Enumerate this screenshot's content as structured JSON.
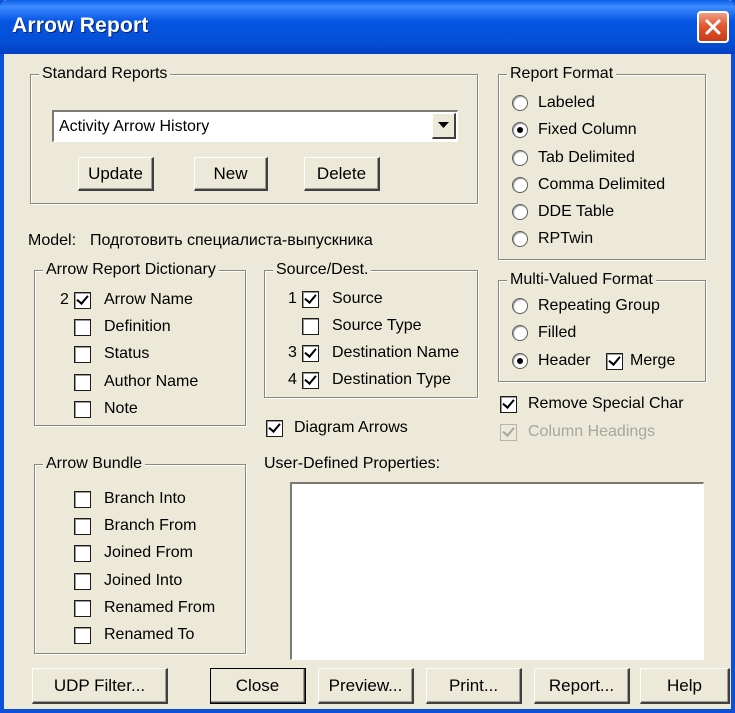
{
  "window": {
    "title": "Arrow Report"
  },
  "standard_reports": {
    "legend": "Standard Reports",
    "selected": "Activity Arrow History",
    "buttons": {
      "update": "Update",
      "new": "New",
      "delete": "Delete"
    }
  },
  "report_format": {
    "legend": "Report Format",
    "options": [
      "Labeled",
      "Fixed Column",
      "Tab Delimited",
      "Comma Delimited",
      "DDE Table",
      "RPTwin"
    ],
    "selected": "Fixed Column"
  },
  "model": {
    "label": "Model:",
    "value": "Подготовить специалиста-выпускника"
  },
  "arrow_report_dictionary": {
    "legend": "Arrow Report Dictionary",
    "items": [
      {
        "label": "Arrow Name",
        "checked": true,
        "order": "2"
      },
      {
        "label": "Definition",
        "checked": false,
        "order": ""
      },
      {
        "label": "Status",
        "checked": false,
        "order": ""
      },
      {
        "label": "Author Name",
        "checked": false,
        "order": ""
      },
      {
        "label": "Note",
        "checked": false,
        "order": ""
      }
    ]
  },
  "source_dest": {
    "legend": "Source/Dest.",
    "items": [
      {
        "label": "Source",
        "checked": true,
        "order": "1"
      },
      {
        "label": "Source Type",
        "checked": false,
        "order": ""
      },
      {
        "label": "Destination Name",
        "checked": true,
        "order": "3"
      },
      {
        "label": "Destination Type",
        "checked": true,
        "order": "4"
      }
    ]
  },
  "multi_valued_format": {
    "legend": "Multi-Valued Format",
    "options": [
      "Repeating Group",
      "Filled",
      "Header"
    ],
    "selected": "Header",
    "merge": {
      "label": "Merge",
      "checked": true
    }
  },
  "options": {
    "remove_special_char": {
      "label": "Remove Special Char",
      "checked": true
    },
    "column_headings": {
      "label": "Column Headings",
      "checked": true,
      "disabled": true
    },
    "diagram_arrows": {
      "label": "Diagram Arrows",
      "checked": true
    }
  },
  "arrow_bundle": {
    "legend": "Arrow Bundle",
    "items": [
      {
        "label": "Branch Into",
        "checked": false
      },
      {
        "label": "Branch From",
        "checked": false
      },
      {
        "label": "Joined From",
        "checked": false
      },
      {
        "label": "Joined Into",
        "checked": false
      },
      {
        "label": "Renamed From",
        "checked": false
      },
      {
        "label": "Renamed To",
        "checked": false
      }
    ]
  },
  "udp": {
    "label": "User-Defined Properties:",
    "value": ""
  },
  "bottom_buttons": {
    "udp_filter": "UDP Filter...",
    "close": "Close",
    "preview": "Preview...",
    "print": "Print...",
    "report": "Report...",
    "help": "Help"
  }
}
